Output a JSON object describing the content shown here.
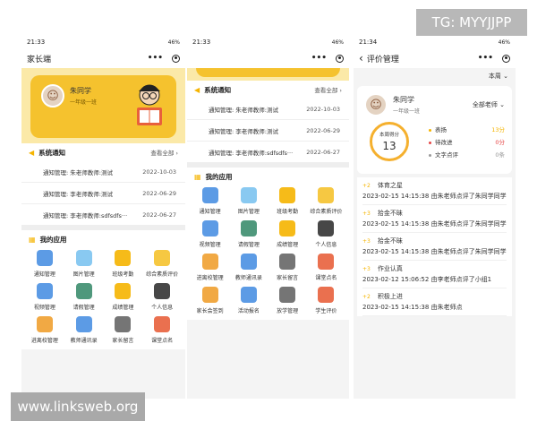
{
  "watermarks": {
    "tg": "TG: MYYJJPP",
    "site": "www.linksweb.org"
  },
  "colors": {
    "accent": "#f5c22e",
    "ring": "#f5b02e",
    "praise": "#f5b400",
    "improve": "#e64646",
    "text_review": "#999999"
  },
  "panel1": {
    "status_time": "21:33",
    "status_right": "46%",
    "nav_title": "家长端",
    "student": {
      "name": "朱同学",
      "class": "一年级一班"
    },
    "notice": {
      "title": "系统通知",
      "more": "查看全部 ›",
      "items": [
        {
          "text": "通知管理: 朱老师教师:测试",
          "date": "2022-10-03"
        },
        {
          "text": "通知管理: 李老师教师:测试",
          "date": "2022-06-29"
        },
        {
          "text": "通知管理: 李老师教师:sdfsdfs···",
          "date": "2022-06-27"
        }
      ]
    },
    "apps_title": "我的应用",
    "apps": [
      {
        "label": "通知管理",
        "icon": "notice-icon",
        "color": "#4a90e2"
      },
      {
        "label": "图片管理",
        "icon": "image-icon",
        "color": "#7cc3f0"
      },
      {
        "label": "班级考勤",
        "icon": "calendar-icon",
        "color": "#f5b400"
      },
      {
        "label": "综合素质评价",
        "icon": "quality-icon",
        "color": "#f5c22e"
      },
      {
        "label": "视频管理",
        "icon": "video-icon",
        "color": "#4a90e2"
      },
      {
        "label": "请假管理",
        "icon": "leave-icon",
        "color": "#3c8d6e"
      },
      {
        "label": "成绩管理",
        "icon": "grade-icon",
        "color": "#f5b400"
      },
      {
        "label": "个人信息",
        "icon": "user-icon",
        "color": "#333333"
      },
      {
        "label": "进离校管理",
        "icon": "clock-icon",
        "color": "#f0a030"
      },
      {
        "label": "教师通讯录",
        "icon": "contacts-icon",
        "color": "#4a90e2"
      },
      {
        "label": "家长留言",
        "icon": "message-icon",
        "color": "#666666"
      },
      {
        "label": "课堂点名",
        "icon": "rollcall-icon",
        "color": "#e8603c"
      }
    ]
  },
  "panel2": {
    "status_time": "21:33",
    "status_right": "46%",
    "nav_title": "",
    "notice": {
      "title": "系统通知",
      "more": "查看全部 ›",
      "items": [
        {
          "text": "通知管理: 朱老师教师:测试",
          "date": "2022-10-03"
        },
        {
          "text": "通知管理: 李老师教师:测试",
          "date": "2022-06-29"
        },
        {
          "text": "通知管理: 李老师教师:sdfsdfs···",
          "date": "2022-06-27"
        }
      ]
    },
    "apps_title": "我的应用",
    "apps": [
      {
        "label": "通知管理",
        "icon": "notice-icon",
        "color": "#4a90e2"
      },
      {
        "label": "图片管理",
        "icon": "image-icon",
        "color": "#7cc3f0"
      },
      {
        "label": "班级考勤",
        "icon": "calendar-icon",
        "color": "#f5b400"
      },
      {
        "label": "综合素质评价",
        "icon": "quality-icon",
        "color": "#f5c22e"
      },
      {
        "label": "视频管理",
        "icon": "video-icon",
        "color": "#4a90e2"
      },
      {
        "label": "请假管理",
        "icon": "leave-icon",
        "color": "#3c8d6e"
      },
      {
        "label": "成绩管理",
        "icon": "grade-icon",
        "color": "#f5b400"
      },
      {
        "label": "个人信息",
        "icon": "user-icon",
        "color": "#333333"
      },
      {
        "label": "进离校管理",
        "icon": "clock-icon",
        "color": "#f0a030"
      },
      {
        "label": "教师通讯录",
        "icon": "contacts-icon",
        "color": "#4a90e2"
      },
      {
        "label": "家长留言",
        "icon": "message-icon",
        "color": "#666666"
      },
      {
        "label": "课堂点名",
        "icon": "rollcall-icon",
        "color": "#e8603c"
      },
      {
        "label": "家长会签到",
        "icon": "signin-icon",
        "color": "#f0a030"
      },
      {
        "label": "活动报名",
        "icon": "activity-icon",
        "color": "#4a90e2"
      },
      {
        "label": "放学管理",
        "icon": "dismissal-icon",
        "color": "#666666"
      },
      {
        "label": "学生评价",
        "icon": "evaluate-icon",
        "color": "#e8603c"
      }
    ]
  },
  "panel3": {
    "status_time": "21:34",
    "status_right": "46%",
    "nav_back": "‹",
    "nav_title": "评价管理",
    "period": "本周",
    "student": {
      "name": "朱同学",
      "class": "一年级一班"
    },
    "teacher_filter": "全部老师",
    "score_label": "本周得分",
    "score_value": "13",
    "stats": [
      {
        "label": "表扬",
        "value": "13分",
        "color": "#f5b400"
      },
      {
        "label": "待改进",
        "value": "0分",
        "color": "#e64646"
      },
      {
        "label": "文字点评",
        "value": "0条",
        "color": "#999999"
      }
    ],
    "records": [
      {
        "points": "+2",
        "title": "体育之星",
        "desc": "2023-02-15 14:15:38 由朱老师点评了朱同学同学"
      },
      {
        "points": "+3",
        "title": "拾金不昧",
        "desc": "2023-02-15 14:15:38 由朱老师点评了朱同学同学"
      },
      {
        "points": "+3",
        "title": "拾金不昧",
        "desc": "2023-02-15 14:15:38 由朱老师点评了朱同学同学"
      },
      {
        "points": "+3",
        "title": "作业认真",
        "desc": "2023-02-12 15:06:52 由李老师点评了小组1"
      },
      {
        "points": "+2",
        "title": "积极上进",
        "desc": "2023-02-15 14:15:38 由朱老师点"
      }
    ]
  }
}
